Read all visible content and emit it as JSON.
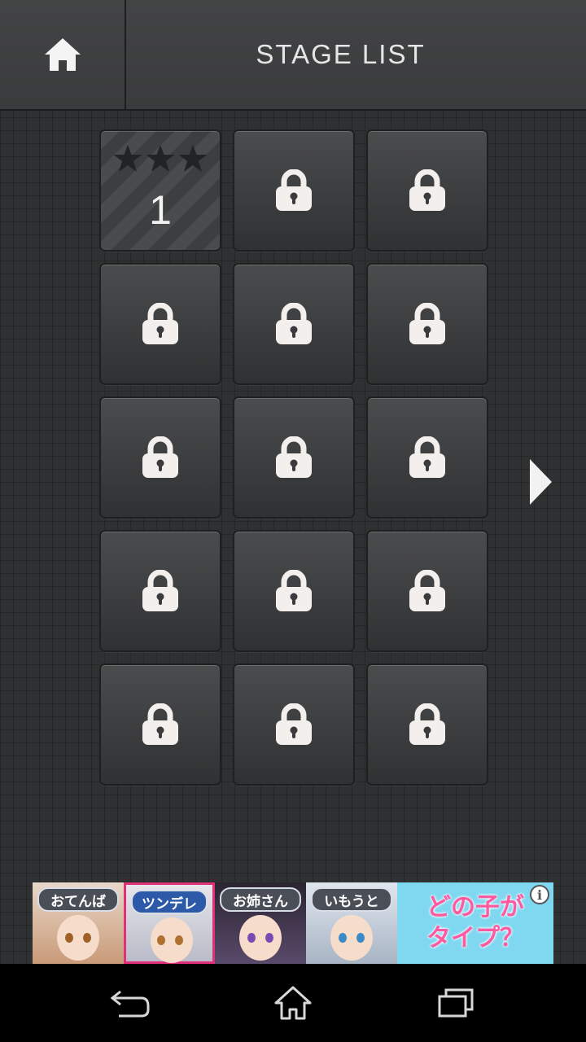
{
  "header": {
    "title": "STAGE LIST",
    "home_icon": "home-icon"
  },
  "stages": [
    {
      "number": "1",
      "locked": false,
      "stars": 3
    },
    {
      "locked": true
    },
    {
      "locked": true
    },
    {
      "locked": true
    },
    {
      "locked": true
    },
    {
      "locked": true
    },
    {
      "locked": true
    },
    {
      "locked": true
    },
    {
      "locked": true
    },
    {
      "locked": true
    },
    {
      "locked": true
    },
    {
      "locked": true
    },
    {
      "locked": true
    },
    {
      "locked": true
    },
    {
      "locked": true
    }
  ],
  "ad": {
    "tags": [
      "おてんば",
      "ツンデレ",
      "お姉さん",
      "いもうと"
    ],
    "selected_tag": "ツンデレ",
    "slogan_line1": "どの子が",
    "slogan_line2": "タイプ？",
    "info_icon": "i"
  },
  "colors": {
    "background": "#2f3031",
    "tile": "#3d3e3f",
    "icon": "#f2f2f2",
    "ad_accent": "#ff5aa0"
  }
}
